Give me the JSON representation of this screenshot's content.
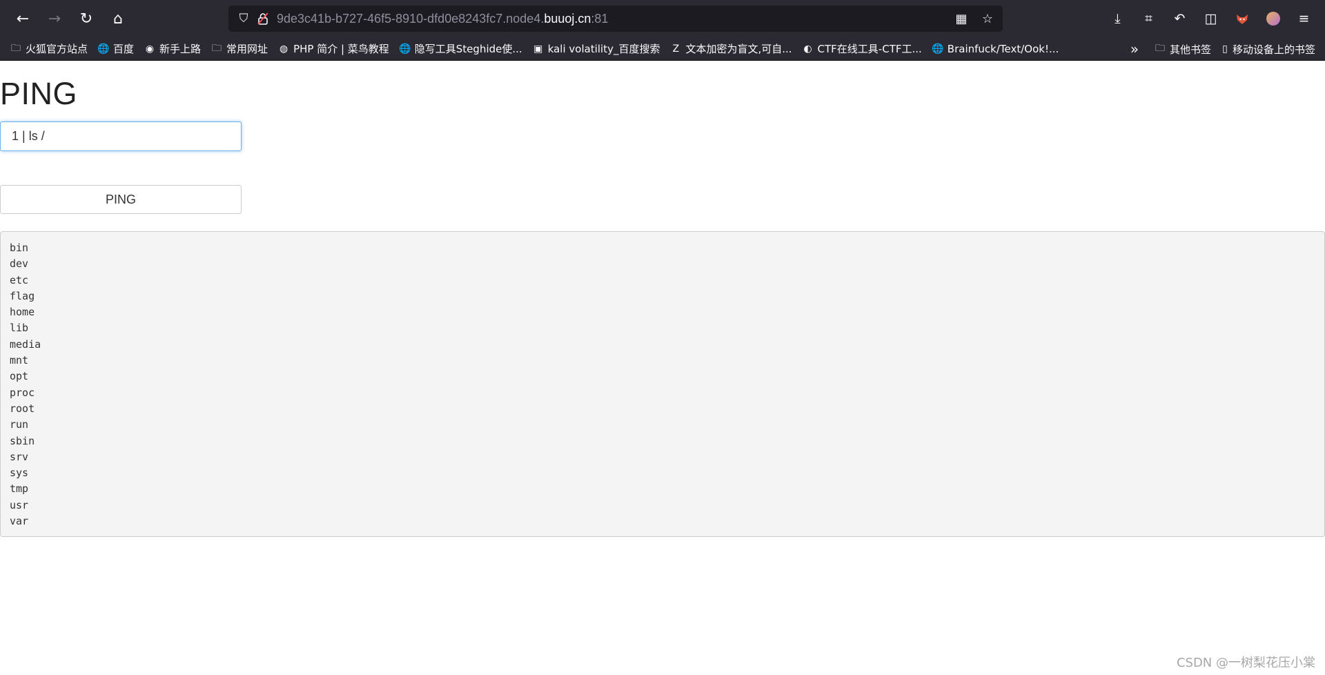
{
  "browser": {
    "nav": {
      "back_icon": "←",
      "forward_icon": "→",
      "reload_icon": "↻",
      "home_icon": "⌂"
    },
    "url": {
      "prefix": "9de3c41b-b727-46f5-8910-dfd0e8243fc7.node4.",
      "host": "buuoj.cn",
      "port": ":81"
    },
    "icons": {
      "shield": "⛉",
      "lock": "🔒",
      "qr": "▦",
      "star": "☆",
      "download": "⤓",
      "crop": "⌗",
      "undo": "↶",
      "reader": "◫",
      "menu": "≡",
      "folder": "🗀",
      "globe": "🌐",
      "overflow": "»",
      "device": "▯"
    },
    "bookmarks": [
      {
        "label": "火狐官方站点",
        "icon": "🗀"
      },
      {
        "label": "百度",
        "icon": "🌐"
      },
      {
        "label": "新手上路",
        "icon": "◉"
      },
      {
        "label": "常用网址",
        "icon": "🗀"
      },
      {
        "label": "PHP 简介 | 菜鸟教程",
        "icon": "◍"
      },
      {
        "label": "隐写工具Steghide使...",
        "icon": "🌐"
      },
      {
        "label": "kali volatility_百度搜索",
        "icon": "▣"
      },
      {
        "label": "文本加密为盲文,可自...",
        "icon": "Z"
      },
      {
        "label": "CTF在线工具-CTF工...",
        "icon": "◐"
      },
      {
        "label": "Brainfuck/Text/Ook!...",
        "icon": "🌐"
      }
    ],
    "bookmarks_right": {
      "other": "其他书签",
      "mobile": "移动设备上的书签"
    }
  },
  "page": {
    "title": "PING",
    "input_value": "1 | ls /",
    "button_label": "PING",
    "result": [
      "bin",
      "dev",
      "etc",
      "flag",
      "home",
      "lib",
      "media",
      "mnt",
      "opt",
      "proc",
      "root",
      "run",
      "sbin",
      "srv",
      "sys",
      "tmp",
      "usr",
      "var"
    ]
  },
  "watermark": "CSDN @一树梨花压小棠"
}
